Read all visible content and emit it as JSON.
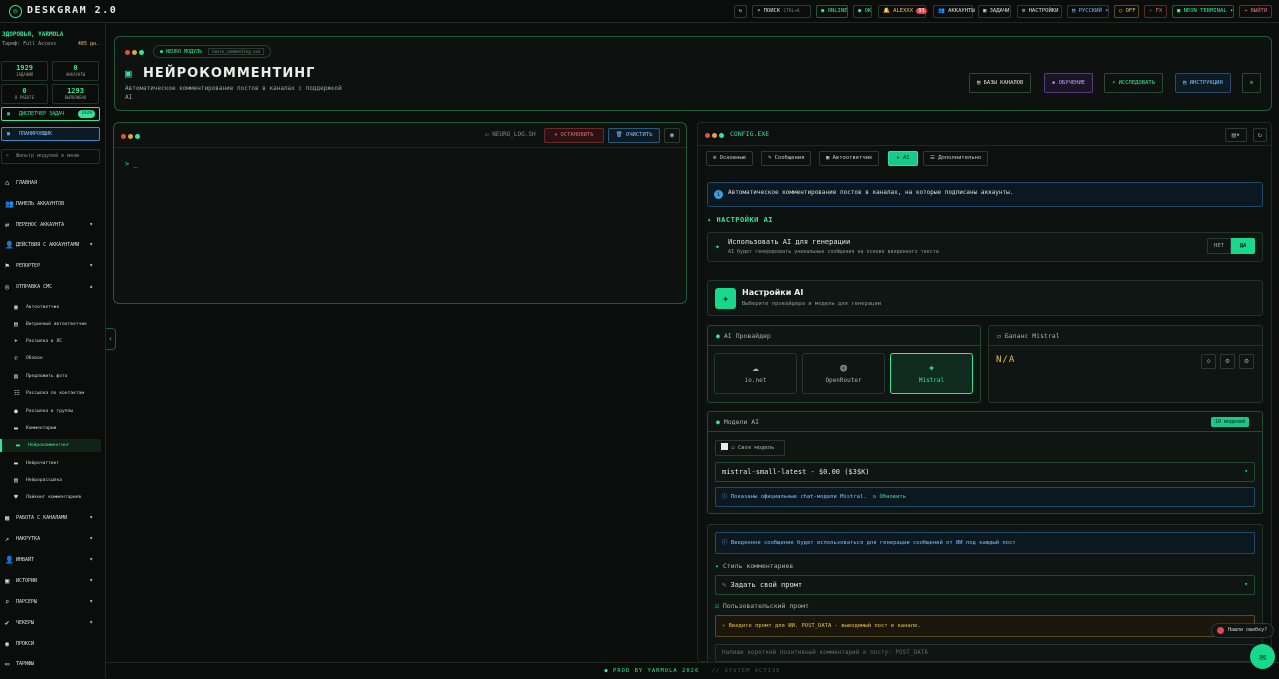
{
  "app": {
    "brand": "DESKGRAM 2.0"
  },
  "topbar": {
    "search": "ПОИСК",
    "search_shortcut": "CTRL+K",
    "online": "ONLINE",
    "ok": "OK",
    "user": "ALEXXX",
    "user_badge": "91",
    "accounts": "АККАУНТЫ",
    "tasks": "ЗАДАЧИ",
    "settings": "НАСТРОЙКИ",
    "language": "РУССКИЙ",
    "off": "OFF",
    "fx": "FX",
    "neon": "NEON TERMINAL",
    "exit": "ВЫЙТИ"
  },
  "sidebar": {
    "greeting": "ЗДОРОВЬЯ, YARMOLA",
    "tariff": "Тариф: Full Access",
    "days": "485 дн.",
    "stats": [
      {
        "value": "1929",
        "label": "ЗАДАНИЙ"
      },
      {
        "value": "0",
        "label": "АККАУНТЫ"
      },
      {
        "value": "0",
        "label": "В РАБОТЕ"
      },
      {
        "value": "1293",
        "label": "ВЫПОЛНЕНО"
      }
    ],
    "dispatcher": "ДИСПЕТЧЕР ЗАДАЧ",
    "dispatcher_badge": "1929",
    "planner": "ПЛАНИРОВЩИК",
    "filter_placeholder": "Фильтр модулей в меню",
    "nav": {
      "home": "ГЛАВНАЯ",
      "accounts_panel": "ПАНЕЛЬ АККАУНТОВ",
      "transfer": "ПЕРЕНОС АККАУНТА",
      "actions": "ДЕЙСТВИЯ С АККАУНТАМИ",
      "reporter": "РЕПОРТЕР",
      "messaging": "ОТПРАВКА СМС",
      "channels": "РАБОТА С КАНАЛАМИ",
      "boosting": "НАКРУТКА",
      "inviting": "ИНВАЙТ",
      "history": "ИСТОРИИ",
      "parsers": "ПАРСЕРЫ",
      "checkers": "ЧЕКЕРЫ",
      "proxy": "ПРОКСИ",
      "tariffs": "ТАРИФЫ"
    },
    "subitems": {
      "s1": "Автоответчик",
      "s2": "Витринный автоответчик",
      "s3": "Рассылка в ЛС",
      "s4": "Обзвон",
      "s5": "Предложить фото",
      "s6": "Рассылка по контактам",
      "s7": "Рассылка в группы",
      "s8": "Комментарии",
      "s9": "Нейрокомментинг",
      "s10": "Нейрочаттинг",
      "s11": "Нейрорассылка",
      "s12": "Лайкинг комментариев"
    }
  },
  "header": {
    "module_tag": "NEURO МОДУЛЬ",
    "module_file": "neuro_commenting.exe",
    "title": "НЕЙРОКОММЕНТИНГ",
    "description": "Автоматическое комментирование постов в каналах с поддержкой AI",
    "btn_bases": "БАЗЫ КАНАЛОВ",
    "btn_learn": "ОБУЧЕНИЕ",
    "btn_explore": "ИССЛЕДОВАТЬ",
    "btn_guide": "ИНСТРУКЦИЯ"
  },
  "terminal": {
    "file": "NEURO_LOG.SH",
    "stop": "ОСТАНОВИТЬ",
    "clear": "ОЧИСТИТЬ",
    "prompt": "> _"
  },
  "config": {
    "file": "CONFIG.EXE",
    "tabs": {
      "t1": "Основные",
      "t2": "Сообщения",
      "t3": "Автоответчик",
      "t4": "AI",
      "t5": "Дополнительно"
    },
    "info": "Автоматическое комментирование постов в каналах, на которые подписаны аккаунты.",
    "ai_settings_heading": "НАСТРОЙКИ AI",
    "use_ai_title": "Использовать AI для генерации",
    "use_ai_desc": "AI будет генерировать уникальные сообщения на основе введенного текста",
    "no": "НЕТ",
    "yes": "ДА",
    "ai_card_title": "Настройки AI",
    "ai_card_desc": "Выберите провайдера и модель для генерации",
    "provider_title": "AI Провайдер",
    "providers": {
      "p1": "io.net",
      "p2": "OpenRouter",
      "p3": "Mistral"
    },
    "balance_title": "Баланс Mistral",
    "balance_value": "N/A",
    "model_title": "Модели AI",
    "model_count": "10 моделей",
    "own_model": "Своя модель",
    "model_selected": "mistral-small-latest - $0.00 ($3$K)",
    "model_note": "Показаны официальные chat-модели Mistral.",
    "refresh": "Обновить",
    "prompt_info": "Введенное сообщение будет использоваться для генерации сообщений от ИИ под каждый пост",
    "style_label": "Стиль комментариев",
    "style_value": "Задать свой промт",
    "custom_prompt_label": "Пользовательский промт",
    "warning": "Введите промт для ИИ. POST_DATA - выводимый пост в канале.",
    "prompt_placeholder": "Напиши короткий позитивный комментарий к посту: POST_DATA"
  },
  "footer": {
    "prod": "PROD BY YARMOLA 2026",
    "status": "// SYSTEM ACTIVE"
  },
  "help": {
    "found_error": "Нашли ошибку?"
  }
}
